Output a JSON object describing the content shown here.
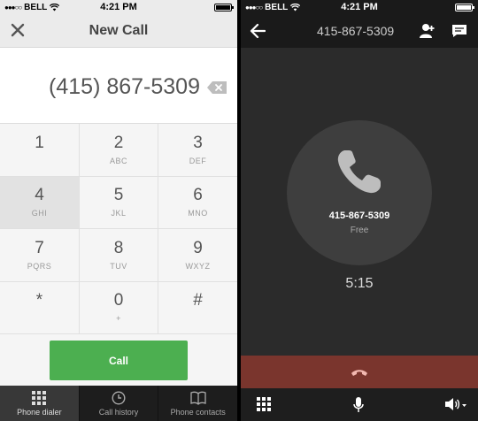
{
  "dialer": {
    "status": {
      "carrier": "BELL",
      "time": "4:21 PM"
    },
    "header": {
      "title": "New Call"
    },
    "dialed_number": "(415) 867-5309",
    "keys": [
      {
        "digit": "1",
        "letters": ""
      },
      {
        "digit": "2",
        "letters": "ABC"
      },
      {
        "digit": "3",
        "letters": "DEF"
      },
      {
        "digit": "4",
        "letters": "GHI"
      },
      {
        "digit": "5",
        "letters": "JKL"
      },
      {
        "digit": "6",
        "letters": "MNO"
      },
      {
        "digit": "7",
        "letters": "PQRS"
      },
      {
        "digit": "8",
        "letters": "TUV"
      },
      {
        "digit": "9",
        "letters": "WXYZ"
      },
      {
        "digit": "*",
        "letters": ""
      },
      {
        "digit": "0",
        "letters": "+"
      },
      {
        "digit": "#",
        "letters": ""
      }
    ],
    "call_label": "Call",
    "tabs": [
      {
        "label": "Phone dialer",
        "icon": "keypad-grid-icon",
        "active": true
      },
      {
        "label": "Call history",
        "icon": "clock-icon",
        "active": false
      },
      {
        "label": "Phone contacts",
        "icon": "book-icon",
        "active": false
      }
    ]
  },
  "in_call": {
    "status": {
      "carrier": "BELL",
      "time": "4:21 PM"
    },
    "header_number": "415-867-5309",
    "callee_number": "415-867-5309",
    "call_type": "Free",
    "timer": "5:15"
  },
  "colors": {
    "call_green": "#4caf50",
    "end_call_red": "#7a352d",
    "dark_bg": "#2a2a2a"
  }
}
